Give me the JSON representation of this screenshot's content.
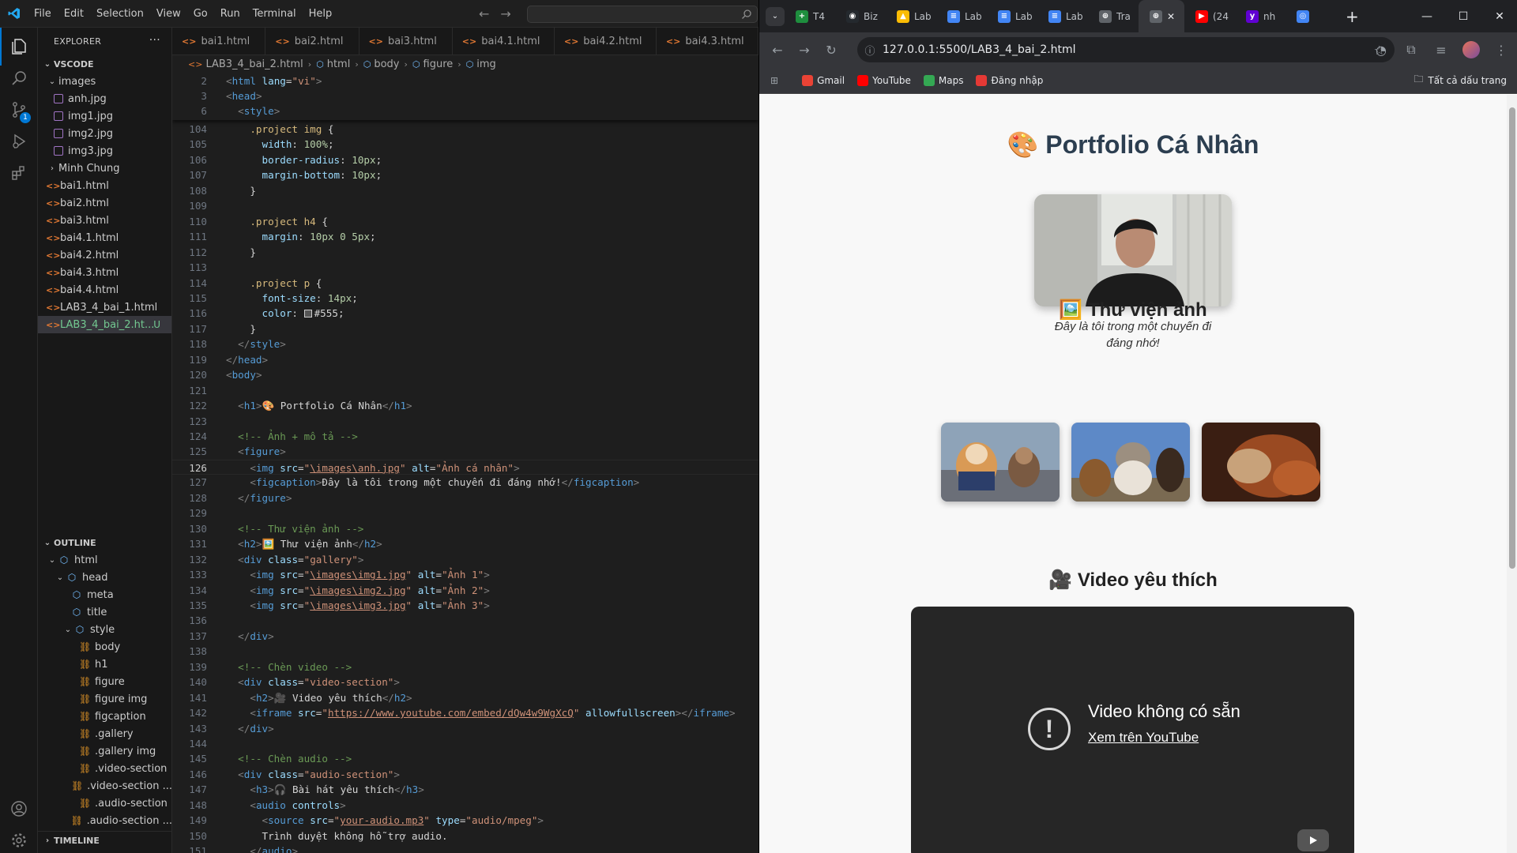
{
  "vscode": {
    "menu": [
      "File",
      "Edit",
      "Selection",
      "View",
      "Go",
      "Run",
      "Terminal",
      "Help"
    ],
    "explorer_title": "EXPLORER",
    "more_glyph": "···",
    "folder_title": "VSCODE",
    "tree": [
      {
        "label": "images",
        "kind": "folder-open",
        "indent": 1
      },
      {
        "label": "anh.jpg",
        "kind": "image",
        "indent": 2
      },
      {
        "label": "img1.jpg",
        "kind": "image",
        "indent": 2
      },
      {
        "label": "img2.jpg",
        "kind": "image",
        "indent": 2
      },
      {
        "label": "img3.jpg",
        "kind": "image",
        "indent": 2
      },
      {
        "label": "Minh Chung",
        "kind": "folder-closed",
        "indent": 1
      },
      {
        "label": "bai1.html",
        "kind": "html",
        "indent": 1
      },
      {
        "label": "bai2.html",
        "kind": "html",
        "indent": 1
      },
      {
        "label": "bai3.html",
        "kind": "html",
        "indent": 1
      },
      {
        "label": "bai4.1.html",
        "kind": "html",
        "indent": 1
      },
      {
        "label": "bai4.2.html",
        "kind": "html",
        "indent": 1
      },
      {
        "label": "bai4.3.html",
        "kind": "html",
        "indent": 1
      },
      {
        "label": "bai4.4.html",
        "kind": "html",
        "indent": 1
      },
      {
        "label": "LAB3_4_bai_1.html",
        "kind": "html",
        "indent": 1
      },
      {
        "label": "LAB3_4_bai_2.ht...",
        "kind": "html-selected",
        "indent": 1,
        "badge": "U"
      }
    ],
    "outline_title": "OUTLINE",
    "outline": [
      {
        "label": "html",
        "kind": "elem",
        "indent": 1
      },
      {
        "label": "head",
        "kind": "elem",
        "indent": 2
      },
      {
        "label": "meta",
        "kind": "elem",
        "indent": 3
      },
      {
        "label": "title",
        "kind": "elem",
        "indent": 3
      },
      {
        "label": "style",
        "kind": "elem",
        "indent": 3
      },
      {
        "label": "body",
        "kind": "rule",
        "indent": 4
      },
      {
        "label": "h1",
        "kind": "rule",
        "indent": 4
      },
      {
        "label": "figure",
        "kind": "rule",
        "indent": 4
      },
      {
        "label": "figure img",
        "kind": "rule",
        "indent": 4
      },
      {
        "label": "figcaption",
        "kind": "rule",
        "indent": 4
      },
      {
        "label": ".gallery",
        "kind": "rule",
        "indent": 4
      },
      {
        "label": ".gallery img",
        "kind": "rule",
        "indent": 4
      },
      {
        "label": ".video-section",
        "kind": "rule",
        "indent": 4
      },
      {
        "label": ".video-section ...",
        "kind": "rule",
        "indent": 4
      },
      {
        "label": ".audio-section",
        "kind": "rule",
        "indent": 4
      },
      {
        "label": ".audio-section ...",
        "kind": "rule",
        "indent": 4
      }
    ],
    "timeline_title": "TIMELINE",
    "tabs": [
      "bai1.html",
      "bai2.html",
      "bai3.html",
      "bai4.1.html",
      "bai4.2.html",
      "bai4.3.html"
    ],
    "breadcrumbs": [
      "LAB3_4_bai_2.html",
      "html",
      "body",
      "figure",
      "img"
    ],
    "source_control_badge": "1",
    "sticky_lines": [
      {
        "n": 2,
        "code": "<html lang=\"vi\">"
      },
      {
        "n": 3,
        "code": "<head>"
      },
      {
        "n": 6,
        "code": "  <style>"
      }
    ],
    "current_line": 126,
    "lines": [
      {
        "n": 104,
        "code": "    .project img {"
      },
      {
        "n": 105,
        "code": "      width: 100%;"
      },
      {
        "n": 106,
        "code": "      border-radius: 10px;"
      },
      {
        "n": 107,
        "code": "      margin-bottom: 10px;"
      },
      {
        "n": 108,
        "code": "    }"
      },
      {
        "n": 109,
        "code": ""
      },
      {
        "n": 110,
        "code": "    .project h4 {"
      },
      {
        "n": 111,
        "code": "      margin: 10px 0 5px;"
      },
      {
        "n": 112,
        "code": "    }"
      },
      {
        "n": 113,
        "code": ""
      },
      {
        "n": 114,
        "code": "    .project p {"
      },
      {
        "n": 115,
        "code": "      font-size: 14px;"
      },
      {
        "n": 116,
        "code": "      color: #555;"
      },
      {
        "n": 117,
        "code": "    }"
      },
      {
        "n": 118,
        "code": "  </style>"
      },
      {
        "n": 119,
        "code": "</head>"
      },
      {
        "n": 120,
        "code": "<body>"
      },
      {
        "n": 121,
        "code": ""
      },
      {
        "n": 122,
        "code": "  <h1>🎨 Portfolio Cá Nhân</h1>"
      },
      {
        "n": 123,
        "code": ""
      },
      {
        "n": 124,
        "code": "  <!-- Ảnh + mô tả -->"
      },
      {
        "n": 125,
        "code": "  <figure>"
      },
      {
        "n": 126,
        "code": "    <img src=\"\\images\\anh.jpg\" alt=\"Ảnh cá nhân\">"
      },
      {
        "n": 127,
        "code": "    <figcaption>Đây là tôi trong một chuyến đi đáng nhớ!</figcaption>"
      },
      {
        "n": 128,
        "code": "  </figure>"
      },
      {
        "n": 129,
        "code": ""
      },
      {
        "n": 130,
        "code": "  <!-- Thư viện ảnh -->"
      },
      {
        "n": 131,
        "code": "  <h2>🖼️ Thư viện ảnh</h2>"
      },
      {
        "n": 132,
        "code": "  <div class=\"gallery\">"
      },
      {
        "n": 133,
        "code": "    <img src=\"\\images\\img1.jpg\" alt=\"Ảnh 1\">"
      },
      {
        "n": 134,
        "code": "    <img src=\"\\images\\img2.jpg\" alt=\"Ảnh 2\">"
      },
      {
        "n": 135,
        "code": "    <img src=\"\\images\\img3.jpg\" alt=\"Ảnh 3\">"
      },
      {
        "n": 136,
        "code": ""
      },
      {
        "n": 137,
        "code": "  </div>"
      },
      {
        "n": 138,
        "code": ""
      },
      {
        "n": 139,
        "code": "  <!-- Chèn video -->"
      },
      {
        "n": 140,
        "code": "  <div class=\"video-section\">"
      },
      {
        "n": 141,
        "code": "    <h2>🎥 Video yêu thích</h2>"
      },
      {
        "n": 142,
        "code": "    <iframe src=\"https://www.youtube.com/embed/dQw4w9WgXcQ\" allowfullscreen></iframe>"
      },
      {
        "n": 143,
        "code": "  </div>"
      },
      {
        "n": 144,
        "code": ""
      },
      {
        "n": 145,
        "code": "  <!-- Chèn audio -->"
      },
      {
        "n": 146,
        "code": "  <div class=\"audio-section\">"
      },
      {
        "n": 147,
        "code": "    <h3>🎧 Bài hát yêu thích</h3>"
      },
      {
        "n": 148,
        "code": "    <audio controls>"
      },
      {
        "n": 149,
        "code": "      <source src=\"your-audio.mp3\" type=\"audio/mpeg\">"
      },
      {
        "n": 150,
        "code": "      Trình duyệt không hỗ trợ audio."
      },
      {
        "n": 151,
        "code": "    </audio>"
      }
    ]
  },
  "chrome": {
    "tabs": [
      {
        "label": "T4",
        "color": "#1e8e3e",
        "glyph": "+"
      },
      {
        "label": "Biz",
        "color": "#24292e",
        "glyph": "◉"
      },
      {
        "label": "Lab",
        "color": "#fbbc04",
        "glyph": "▲"
      },
      {
        "label": "Lab",
        "color": "#4285f4",
        "glyph": "≡"
      },
      {
        "label": "Lab",
        "color": "#4285f4",
        "glyph": "≡"
      },
      {
        "label": "Lab",
        "color": "#4285f4",
        "glyph": "≡"
      },
      {
        "label": "Tra",
        "color": "#5f6368",
        "glyph": "⊕"
      },
      {
        "label": "",
        "color": "#5f6368",
        "glyph": "⊕",
        "active": true
      },
      {
        "label": "(24",
        "color": "#ff0000",
        "glyph": "▶"
      },
      {
        "label": "nh",
        "color": "#6001d2",
        "glyph": "y"
      },
      {
        "label": "",
        "color": "#4285f4",
        "glyph": "◎"
      }
    ],
    "tab_close_glyph": "✕",
    "new_tab_glyph": "+",
    "url": "127.0.0.1:5500/LAB3_4_bai_2.html",
    "bookmarks": [
      {
        "label": "Gmail",
        "color": "#ea4335"
      },
      {
        "label": "YouTube",
        "color": "#ff0000"
      },
      {
        "label": "Maps",
        "color": "#34a853"
      },
      {
        "label": "Đăng nhập",
        "color": "#e53935"
      }
    ],
    "all_bookmarks": "Tất cả dấu trang"
  },
  "page": {
    "title": "Portfolio Cá Nhân",
    "title_emoji": "🎨",
    "caption": "Đây là tôi trong một chuyến đi đáng nhớ!",
    "gallery_heading": "Thư viện ảnh",
    "gallery_emoji": "🖼️",
    "video_heading": "Video yêu thích",
    "video_emoji": "🎥",
    "video_unavailable": "Video không có sẵn",
    "video_link": "Xem trên YouTube"
  }
}
